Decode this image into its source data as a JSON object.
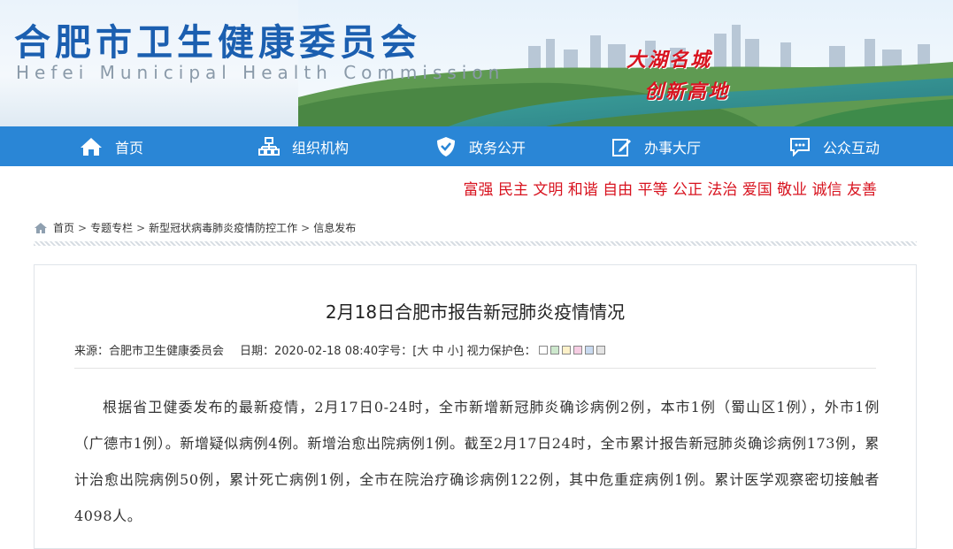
{
  "header": {
    "title": "合肥市卫生健康委员会",
    "subtitle": "Hefei Municipal Health Commission",
    "slogan_line1": "大湖名城",
    "slogan_line2": "创新高地"
  },
  "nav": {
    "items": [
      {
        "label": "首页",
        "icon": "home-icon"
      },
      {
        "label": "组织机构",
        "icon": "org-chart-icon"
      },
      {
        "label": "政务公开",
        "icon": "shield-icon"
      },
      {
        "label": "办事大厅",
        "icon": "edit-icon"
      },
      {
        "label": "公众互动",
        "icon": "chat-icon"
      }
    ]
  },
  "values_text": "富强 民主 文明 和谐 自由 平等 公正 法治 爱国 敬业 诚信 友善",
  "breadcrumb": {
    "items": [
      "首页",
      "专题专栏",
      "新型冠状病毒肺炎疫情防控工作",
      "信息发布"
    ],
    "separator": ">"
  },
  "article": {
    "title": "2月18日合肥市报告新冠肺炎疫情情况",
    "meta_source": "来源：合肥市卫生健康委员会",
    "meta_date": "日期：2020-02-18 08:40",
    "meta_fontsize_label": "字号：",
    "meta_fontsize_options": "[大 中 小]",
    "meta_eyecare_label": "视力保护色：",
    "swatch_colors": [
      "#ffffff",
      "#cde8cd",
      "#fdf1c9",
      "#f6cde3",
      "#c9daf0",
      "#e4e4e4"
    ],
    "body": "根据省卫健委发布的最新疫情，2月17日0-24时，全市新增新冠肺炎确诊病例2例，本市1例（蜀山区1例），外市1例（广德市1例）。新增疑似病例4例。新增治愈出院病例1例。截至2月17日24时，全市累计报告新冠肺炎确诊病例173例，累计治愈出院病例50例，累计死亡病例1例，全市在院治疗确诊病例122例，其中危重症病例1例。累计医学观察密切接触者4098人。"
  }
}
